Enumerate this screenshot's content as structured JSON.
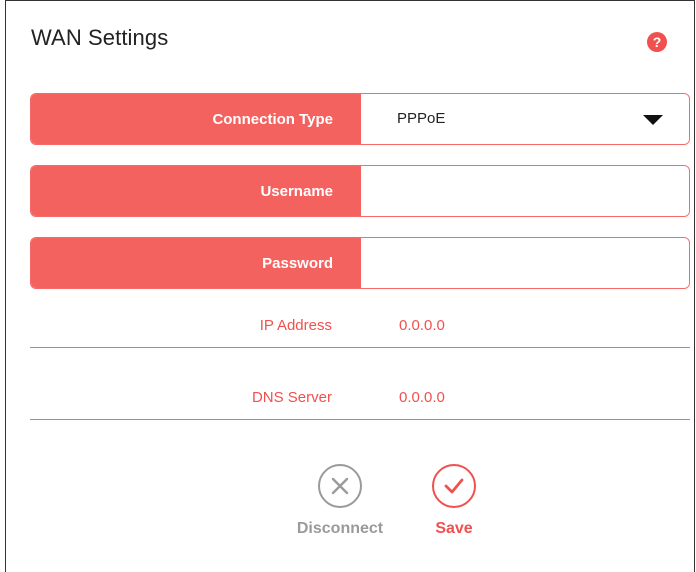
{
  "header": {
    "title": "WAN Settings",
    "help_glyph": "?"
  },
  "form": {
    "connection_type": {
      "label": "Connection Type",
      "value": "PPPoE"
    },
    "username": {
      "label": "Username",
      "value": ""
    },
    "password": {
      "label": "Password",
      "value": ""
    }
  },
  "status": {
    "ip_address": {
      "label": "IP Address",
      "value": "0.0.0.0"
    },
    "dns_server": {
      "label": "DNS Server",
      "value": "0.0.0.0"
    }
  },
  "actions": {
    "disconnect_label": "Disconnect",
    "save_label": "Save"
  },
  "icons": {
    "help": "help-icon",
    "dropdown": "chevron-down-icon",
    "disconnect": "close-circle-icon",
    "save": "check-circle-icon"
  },
  "colors": {
    "accent": "#f4625f",
    "accent_text": "#f0504e",
    "disabled": "#9a9a9a"
  }
}
